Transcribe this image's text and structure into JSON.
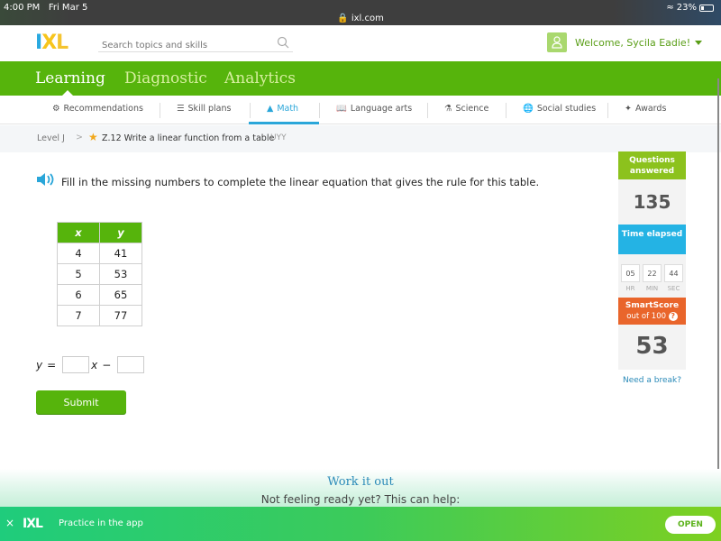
{
  "status_bar": {
    "time": "4:00 PM",
    "date": "Fri Mar 5",
    "url": "ixl.com",
    "battery": "23%"
  },
  "header": {
    "logo": {
      "i": "I",
      "x": "X",
      "l": "L"
    },
    "search_placeholder": "Search topics and skills",
    "welcome": "Welcome, Sycila Eadie!"
  },
  "main_nav": [
    {
      "label": "Learning",
      "active": true
    },
    {
      "label": "Diagnostic",
      "active": false
    },
    {
      "label": "Analytics",
      "active": false
    }
  ],
  "sub_nav": [
    {
      "label": "Recommendations",
      "icon": "recommendations-icon"
    },
    {
      "label": "Skill plans",
      "icon": "skill-plans-icon"
    },
    {
      "label": "Math",
      "icon": "math-pyramid-icon",
      "active": true
    },
    {
      "label": "Language arts",
      "icon": "book-icon"
    },
    {
      "label": "Science",
      "icon": "flask-icon"
    },
    {
      "label": "Social studies",
      "icon": "globe-icon"
    },
    {
      "label": "Awards",
      "icon": "awards-icon"
    }
  ],
  "breadcrumb": {
    "level": "Level J",
    "separator": ">",
    "skill": "Z.12 Write a linear function from a table",
    "code": "UYY"
  },
  "question": {
    "prompt": "Fill in the missing numbers to complete the linear equation that gives the rule for this table.",
    "table": {
      "headers": [
        "x",
        "y"
      ],
      "rows": [
        [
          "4",
          "41"
        ],
        [
          "5",
          "53"
        ],
        [
          "6",
          "65"
        ],
        [
          "7",
          "77"
        ]
      ]
    },
    "equation": {
      "lhs": "y",
      "equals": "=",
      "var": "x",
      "op": "−",
      "input1_value": "",
      "input2_value": ""
    },
    "submit_label": "Submit"
  },
  "sidebar": {
    "questions_answered_label": "Questions answered",
    "questions_answered": "135",
    "time_elapsed_label": "Time elapsed",
    "time": [
      {
        "value": "05",
        "unit": "HR"
      },
      {
        "value": "22",
        "unit": "MIN"
      },
      {
        "value": "44",
        "unit": "SEC"
      }
    ],
    "smartscore_label": "SmartScore",
    "smartscore_sub": "out of 100",
    "smartscore_help": "?",
    "smartscore": "53",
    "need_break": "Need a break?"
  },
  "work_it_out": {
    "title": "Work it out",
    "subtitle": "Not feeling ready yet? This can help:"
  },
  "app_banner": {
    "close": "×",
    "logo": "IXL",
    "text": "Practice in the app",
    "open_label": "OPEN"
  }
}
